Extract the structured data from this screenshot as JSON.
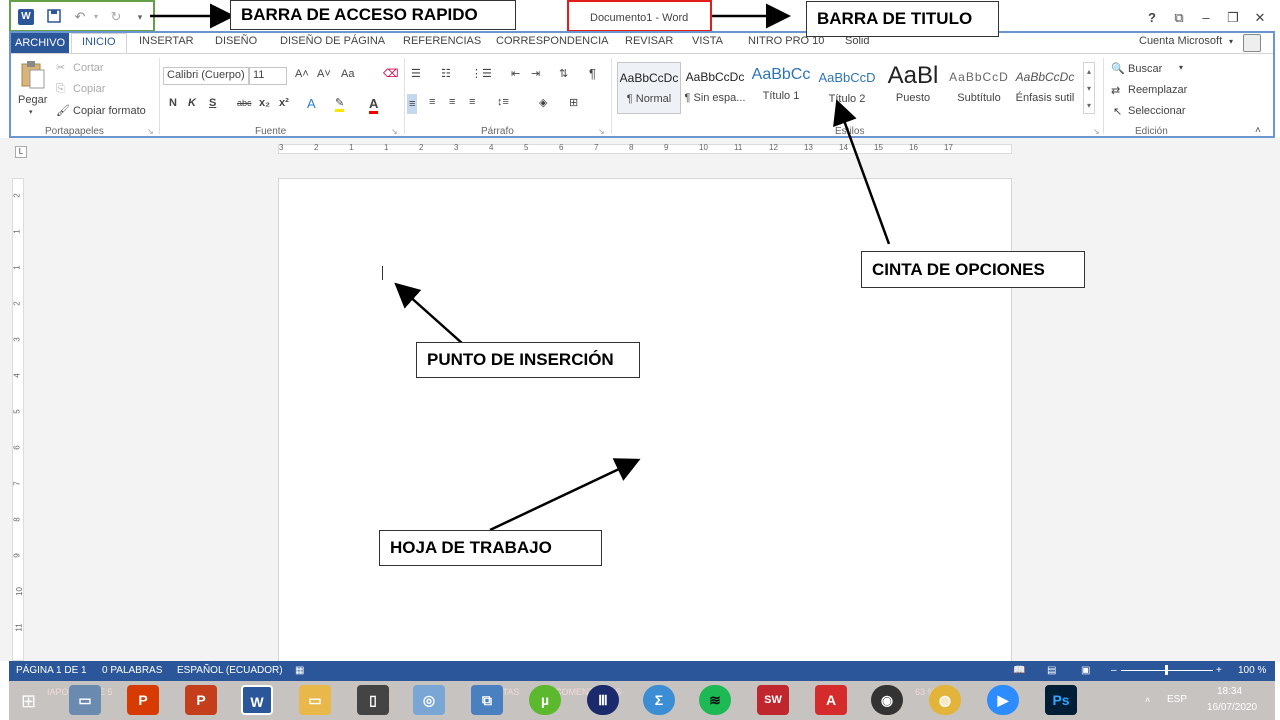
{
  "qat": {
    "undo_icon": "undo-icon",
    "redo_icon": "repeat-icon",
    "customize_icon": "chevron-down-icon"
  },
  "title": {
    "text": "Documento1 - Word"
  },
  "window": {
    "help": "?",
    "ribbon_display": "⧉",
    "minimize": "–",
    "restore": "❐",
    "close": "✕"
  },
  "tabs": [
    "ARCHIVO",
    "INICIO",
    "INSERTAR",
    "DISEÑO",
    "DISEÑO DE PÁGINA",
    "REFERENCIAS",
    "CORRESPONDENCIA",
    "REVISAR",
    "VISTA",
    "NITRO PRO 10",
    "Solid"
  ],
  "account": "Cuenta Microsoft",
  "clipboard": {
    "paste": "Pegar",
    "cut": "Cortar",
    "copy": "Copiar",
    "format_painter": "Copiar formato",
    "label": "Portapapeles"
  },
  "font": {
    "name": "Calibri (Cuerpo)",
    "size": "11",
    "grow": "A˄",
    "shrink": "A˅",
    "case": "Aa",
    "bold": "N",
    "italic": "K",
    "underline": "S",
    "strike": "abc",
    "sub": "x₂",
    "sup": "x²",
    "label": "Fuente"
  },
  "paragraph": {
    "label": "Párrafo",
    "marks": "¶"
  },
  "styles": {
    "label": "Estilos",
    "items": [
      {
        "preview": "AaBbCcDc",
        "name": "¶ Normal"
      },
      {
        "preview": "AaBbCcDc",
        "name": "¶ Sin espa..."
      },
      {
        "preview": "AaBbCc",
        "name": "Título 1"
      },
      {
        "preview": "AaBbCcD",
        "name": "Título 2"
      },
      {
        "preview": "AaBl",
        "name": "Puesto"
      },
      {
        "preview": "AaBbCcD",
        "name": "Subtítulo"
      },
      {
        "preview": "AaBbCcDc",
        "name": "Énfasis sutil"
      }
    ]
  },
  "editing": {
    "find": "Buscar",
    "replace": "Reemplazar",
    "select": "Seleccionar",
    "label": "Edición"
  },
  "ruler": {
    "numbers": [
      "3",
      "2",
      "1",
      "1",
      "2",
      "3",
      "4",
      "5",
      "6",
      "7",
      "8",
      "9",
      "10",
      "11",
      "12",
      "13",
      "14",
      "15",
      "16",
      "17"
    ]
  },
  "vruler": {
    "numbers": [
      "2",
      "1",
      "1",
      "2",
      "3",
      "4",
      "5",
      "6",
      "7",
      "8",
      "9",
      "10",
      "11"
    ]
  },
  "status": {
    "page": "PÁGINA 1 DE 1",
    "words": "0 PALABRAS",
    "language": "ESPAÑOL (ECUADOR)",
    "zoom": "100 %",
    "zoom_minus": "–",
    "zoom_plus": "+"
  },
  "taskbar": {
    "lang": "ESP",
    "time": "18:34",
    "date": "16/07/2020",
    "ghost": [
      "IAPO",
      "3 DE 5",
      "NOTAS",
      "COMENTARIOS",
      "63 %"
    ]
  },
  "annotations": {
    "qat": "BARRA DE ACCESO RAPIDO",
    "title": "BARRA DE TITULO",
    "ribbon": "CINTA DE OPCIONES",
    "insertion": "PUNTO DE INSERCIÓN",
    "sheet": "HOJA DE TRABAJO"
  },
  "colors": {
    "word_blue": "#2b579a",
    "qat_outline": "#63a047",
    "title_outline": "#e31c1c",
    "ribbon_outline": "#6c96cf"
  }
}
